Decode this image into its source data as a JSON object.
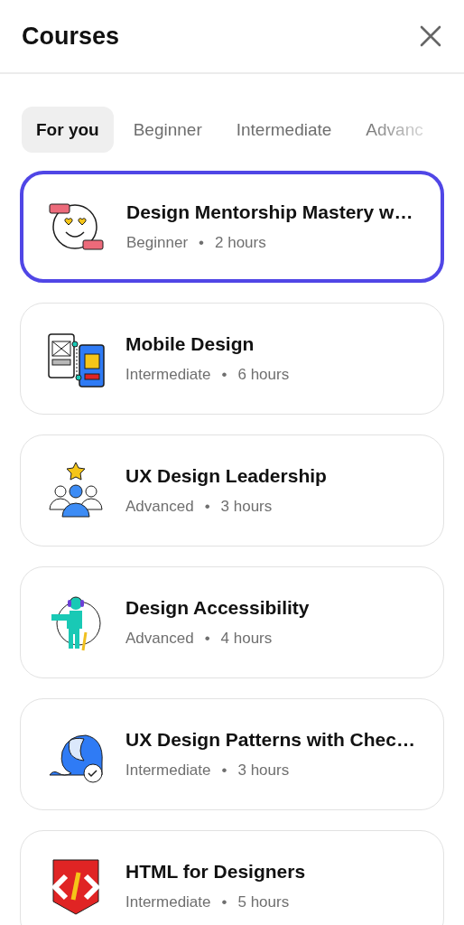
{
  "header": {
    "title": "Courses"
  },
  "tabs": [
    {
      "label": "For you",
      "selected": true
    },
    {
      "label": "Beginner",
      "selected": false
    },
    {
      "label": "Intermediate",
      "selected": false
    },
    {
      "label": "Advanc",
      "selected": false
    }
  ],
  "courses": [
    {
      "title": "Design Mentorship Mastery w…",
      "level": "Beginner",
      "separator": "•",
      "duration": "2 hours",
      "selected": true
    },
    {
      "title": "Mobile Design",
      "level": "Intermediate",
      "separator": "•",
      "duration": "6 hours",
      "selected": false
    },
    {
      "title": "UX Design Leadership",
      "level": "Advanced",
      "separator": "•",
      "duration": "3 hours",
      "selected": false
    },
    {
      "title": "Design Accessibility",
      "level": "Advanced",
      "separator": "•",
      "duration": "4 hours",
      "selected": false
    },
    {
      "title": "UX Design Patterns with Chec…",
      "level": "Intermediate",
      "separator": "•",
      "duration": "3 hours",
      "selected": false
    },
    {
      "title": "HTML for Designers",
      "level": "Intermediate",
      "separator": "•",
      "duration": "5 hours",
      "selected": false
    }
  ]
}
